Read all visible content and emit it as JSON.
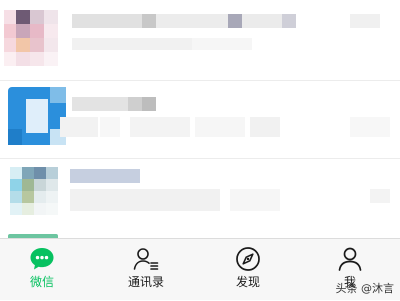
{
  "colors": {
    "active": "#07c160",
    "inactive": "#1a1a1a",
    "tabbar_bg": "#f7f7f7",
    "divider": "#ececec"
  },
  "tabbar": {
    "tabs": [
      {
        "label": "微信",
        "icon": "chat-bubble-icon",
        "active": true
      },
      {
        "label": "通讯录",
        "icon": "contacts-icon",
        "active": false
      },
      {
        "label": "发现",
        "icon": "compass-icon",
        "active": false
      },
      {
        "label": "我",
        "icon": "person-icon",
        "active": false
      }
    ]
  },
  "watermark": "头条 @沐言"
}
